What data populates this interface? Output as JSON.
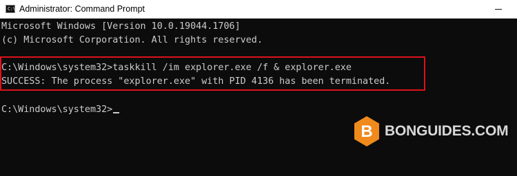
{
  "window": {
    "title": "Administrator: Command Prompt",
    "icon": "cmd-icon",
    "icon_glyph": "C:\\"
  },
  "titlebar_buttons": {
    "minimize_icon": "minimize-icon"
  },
  "console": {
    "lines": [
      "Microsoft Windows [Version 10.0.19044.1706]",
      "(c) Microsoft Corporation. All rights reserved.",
      "C:\\Windows\\system32>taskkill /im explorer.exe /f & explorer.exe",
      "SUCCESS: The process \"explorer.exe\" with PID 4136 has been terminated.",
      "C:\\Windows\\system32>"
    ],
    "text_color": "#cccccc",
    "background": "#0c0c0c",
    "highlight_color": "#e0101a"
  },
  "watermark": {
    "logo_letter": "B",
    "text": "BONGUIDES.COM",
    "logo_color": "#f08a1c"
  }
}
